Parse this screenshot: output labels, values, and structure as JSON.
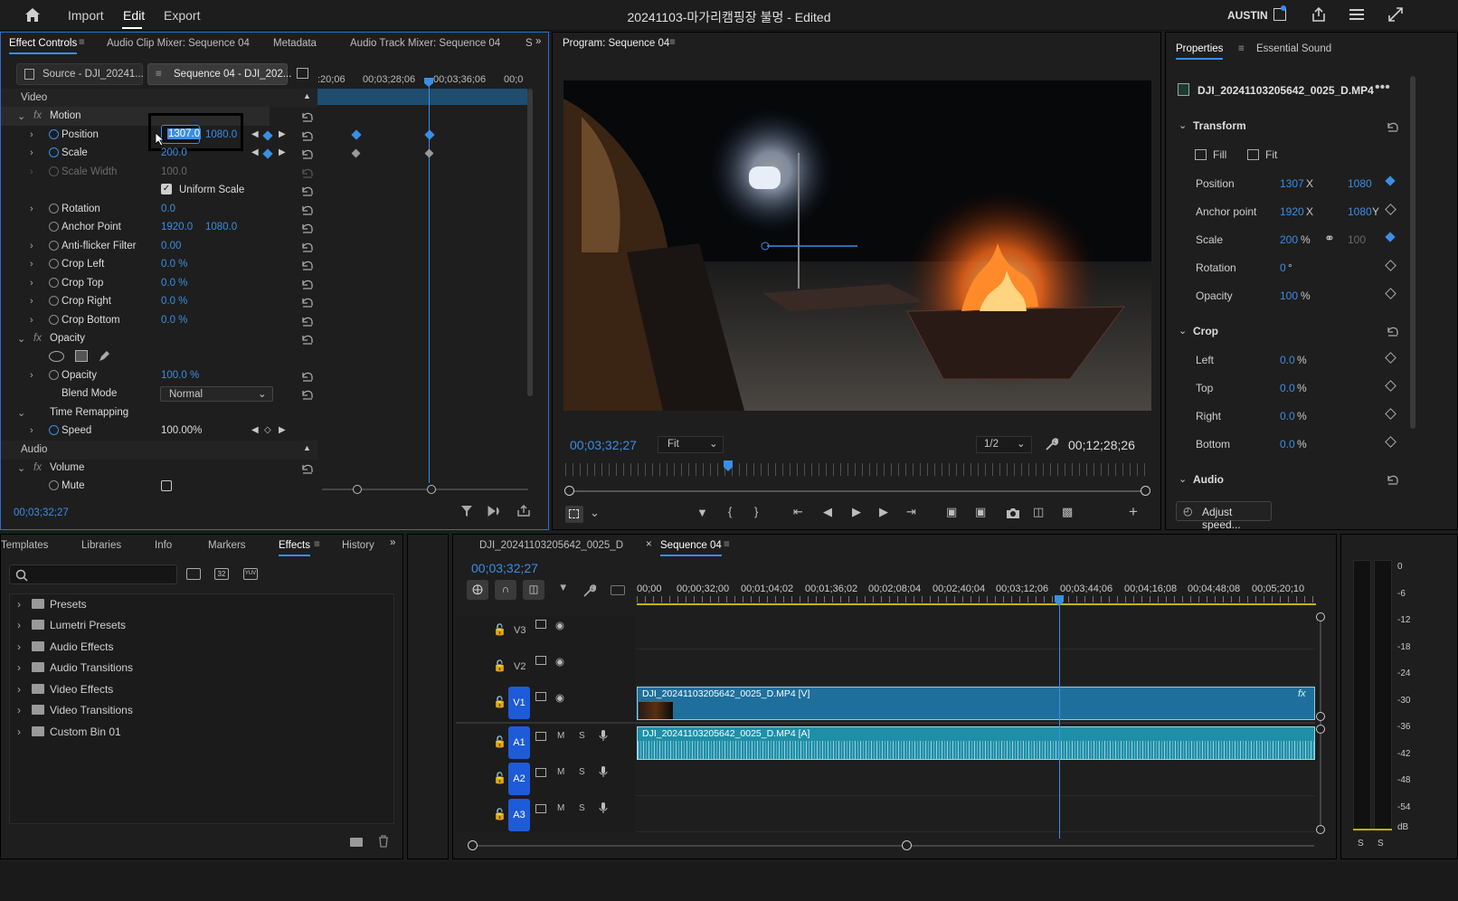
{
  "topbar": {
    "menu": [
      "Import",
      "Edit",
      "Export"
    ],
    "title": "20241103-마가리캠핑장 불멍 - Edited",
    "user": "AUSTIN"
  },
  "effect_controls": {
    "tabs": [
      "Effect Controls",
      "Audio Clip Mixer: Sequence 04",
      "Metadata",
      "Audio Track Mixer: Sequence 04",
      "S"
    ],
    "source_tab": "Source - DJI_20241...",
    "sequence_tab": "Sequence 04 - DJI_202...",
    "ruler": [
      ":20;06",
      "00;03;28;06",
      "00;03;36;06",
      "00;0"
    ],
    "sections": {
      "video": "Video",
      "audio": "Audio"
    },
    "rows": {
      "motion": "Motion",
      "position": {
        "label": "Position",
        "x": "1307.0",
        "y": "1080.0"
      },
      "scale": {
        "label": "Scale",
        "value": "200.0"
      },
      "scale_width": {
        "label": "Scale Width",
        "value": "100.0"
      },
      "uniform_scale": "Uniform Scale",
      "rotation": {
        "label": "Rotation",
        "value": "0.0"
      },
      "anchor": {
        "label": "Anchor Point",
        "x": "1920.0",
        "y": "1080.0"
      },
      "antiflicker": {
        "label": "Anti-flicker Filter",
        "value": "0.00"
      },
      "crop_left": {
        "label": "Crop Left",
        "value": "0.0 %"
      },
      "crop_top": {
        "label": "Crop Top",
        "value": "0.0 %"
      },
      "crop_right": {
        "label": "Crop Right",
        "value": "0.0 %"
      },
      "crop_bottom": {
        "label": "Crop Bottom",
        "value": "0.0 %"
      },
      "opacity_fx": "Opacity",
      "opacity": {
        "label": "Opacity",
        "value": "100.0 %"
      },
      "blend_mode": {
        "label": "Blend Mode",
        "value": "Normal"
      },
      "time_remap": "Time Remapping",
      "speed": {
        "label": "Speed",
        "value": "100.00%"
      },
      "volume": "Volume",
      "mute": "Mute"
    },
    "timecode": "00;03;32;27"
  },
  "program": {
    "title": "Program: Sequence 04",
    "timecode": "00;03;32;27",
    "fit": "Fit",
    "resolution": "1/2",
    "duration": "00;12;28;26"
  },
  "properties": {
    "tabs": [
      "Properties",
      "Essential Sound"
    ],
    "clip": "DJI_20241103205642_0025_D.MP4",
    "transform": "Transform",
    "fill": "Fill",
    "fit": "Fit",
    "position": {
      "label": "Position",
      "x": "1307",
      "y": "1080"
    },
    "anchor": {
      "label": "Anchor point",
      "x": "1920",
      "y": "1080"
    },
    "scale": {
      "label": "Scale",
      "value": "200",
      "linked": "100"
    },
    "rotation": {
      "label": "Rotation",
      "value": "0"
    },
    "opacity": {
      "label": "Opacity",
      "value": "100"
    },
    "crop": "Crop",
    "crop_left": {
      "label": "Left",
      "value": "0.0"
    },
    "crop_top": {
      "label": "Top",
      "value": "0.0"
    },
    "crop_right": {
      "label": "Right",
      "value": "0.0"
    },
    "crop_bottom": {
      "label": "Bottom",
      "value": "0.0"
    },
    "audio": "Audio",
    "adjust_speed": "Adjust speed..."
  },
  "effects_panel": {
    "tabs": [
      "Templates",
      "Libraries",
      "Info",
      "Markers",
      "Effects",
      "History"
    ],
    "search_placeholder": "",
    "tree": [
      "Presets",
      "Lumetri Presets",
      "Audio Effects",
      "Audio Transitions",
      "Video Effects",
      "Video Transitions",
      "Custom Bin 01"
    ]
  },
  "timeline": {
    "tabs": [
      "DJI_20241103205642_0025_D",
      "Sequence 04"
    ],
    "timecode": "00;03;32;27",
    "ruler": [
      "00;00",
      "00;00;32;00",
      "00;01;04;02",
      "00;01;36;02",
      "00;02;08;04",
      "00;02;40;04",
      "00;03;12;06",
      "00;03;44;06",
      "00;04;16;08",
      "00;04;48;08",
      "00;05;20;10"
    ],
    "tracks": [
      "V3",
      "V2",
      "V1",
      "A1",
      "A2",
      "A3"
    ],
    "video_clip": "DJI_20241103205642_0025_D.MP4 [V]",
    "audio_clip": "DJI_20241103205642_0025_D.MP4 [A]",
    "fx": "fx",
    "mute_letter": "M",
    "solo_letter": "S"
  },
  "meter": {
    "scale": [
      "0",
      "-6",
      "-12",
      "-18",
      "-24",
      "-30",
      "-36",
      "-42",
      "-48",
      "-54",
      "dB"
    ],
    "bottom": [
      "S",
      "S"
    ]
  },
  "colors": {
    "accent": "#3a8ee6",
    "clip_video": "#1f6f9c",
    "clip_audio": "#1f8fa8",
    "track_blue": "#1e5bd8"
  }
}
